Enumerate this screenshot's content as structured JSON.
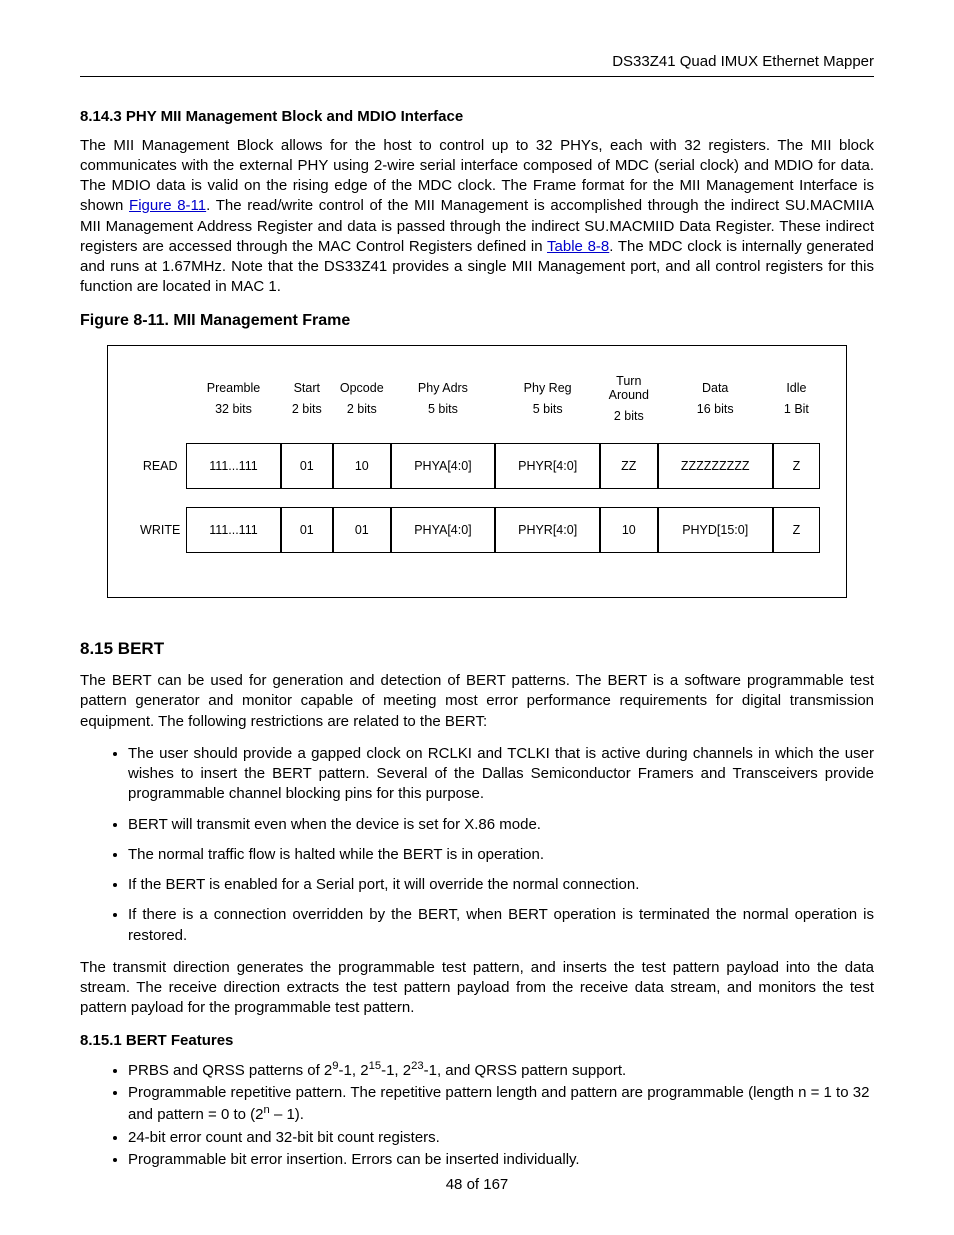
{
  "header": {
    "docTitle": "DS33Z41 Quad IMUX Ethernet Mapper"
  },
  "sec8143": {
    "heading": "8.14.3  PHY MII Management Block and MDIO Interface",
    "para_a": "The MII Management Block allows for the host to control up to 32 PHYs, each with 32 registers. The MII block communicates with the external PHY using 2-wire serial interface composed of MDC (serial clock) and MDIO for data. The MDIO data is valid on the rising edge of the MDC clock. The Frame format for the MII Management Interface is shown ",
    "link1": "Figure 8-11",
    "para_b": ". The read/write control of the MII Management is accomplished through the indirect SU.MACMIIA MII Management Address Register and data is passed through the indirect SU.MACMIID Data Register. These indirect registers are accessed through the MAC Control Registers defined in ",
    "link2": "Table 8-8",
    "para_c": ". The MDC clock is internally generated and runs at 1.67MHz. Note that the DS33Z41 provides a single MII Management port, and all control registers for this function are located in MAC 1."
  },
  "figure": {
    "caption": "Figure 8-11. MII Management Frame",
    "headers": [
      {
        "top": "",
        "bot": ""
      },
      {
        "top": "Preamble",
        "bot": "32 bits"
      },
      {
        "top": "Start",
        "bot": "2 bits"
      },
      {
        "top": "Opcode",
        "bot": "2 bits"
      },
      {
        "top": "Phy Adrs",
        "bot": "5 bits"
      },
      {
        "top": "Phy Reg",
        "bot": "5 bits"
      },
      {
        "top": "Turn Around",
        "bot": "2 bits"
      },
      {
        "top": "Data",
        "bot": "16 bits"
      },
      {
        "top": "Idle",
        "bot": "1 Bit"
      }
    ],
    "rows": [
      {
        "label": "READ",
        "cells": [
          "111...111",
          "01",
          "10",
          "PHYA[4:0]",
          "PHYR[4:0]",
          "ZZ",
          "ZZZZZZZZZ",
          "Z"
        ]
      },
      {
        "label": "WRITE",
        "cells": [
          "111...111",
          "01",
          "01",
          "PHYA[4:0]",
          "PHYR[4:0]",
          "10",
          "PHYD[15:0]",
          "Z"
        ]
      }
    ]
  },
  "sec815": {
    "heading": "8.15  BERT",
    "para1": "The BERT can be used for generation and detection of BERT patterns. The BERT is a software programmable test pattern generator and monitor capable of meeting most error performance requirements for digital transmission equipment. The following restrictions are related to the BERT:",
    "bullets": [
      "The user should provide a gapped clock on RCLKI and TCLKI that is active during channels in which the user wishes to insert the BERT pattern. Several of the Dallas Semiconductor Framers and Transceivers provide programmable channel blocking pins for this purpose.",
      "BERT will transmit even when the device is set for X.86 mode.",
      "The normal traffic flow is halted while the BERT is in operation.",
      "If the BERT is enabled for a Serial port, it will override the normal connection.",
      "If there is a connection overridden by the BERT, when BERT operation is terminated the normal operation is restored."
    ],
    "para2": "The transmit direction generates the programmable test pattern, and inserts the test pattern payload into the data stream. The receive direction extracts the test pattern payload from the receive data stream, and monitors the test pattern payload for the programmable test pattern."
  },
  "sec8151": {
    "heading": "8.15.1  BERT Features",
    "b1_a": "PRBS and QRSS patterns of 2",
    "b1_b": "-1, 2",
    "b1_c": "-1, 2",
    "b1_d": "-1, and QRSS pattern support.",
    "b1_e9": "9",
    "b1_e15": "15",
    "b1_e23": "23",
    "b2_a": "Programmable repetitive pattern. The repetitive pattern length and pattern are programmable (length n = 1 to 32 and pattern = 0 to (2",
    "b2_exp": "n",
    "b2_b": " – 1).",
    "b3": "24-bit error count and 32-bit bit count registers.",
    "b4": "Programmable bit error insertion. Errors can be inserted individually."
  },
  "footer": {
    "text": "48 of 167"
  }
}
